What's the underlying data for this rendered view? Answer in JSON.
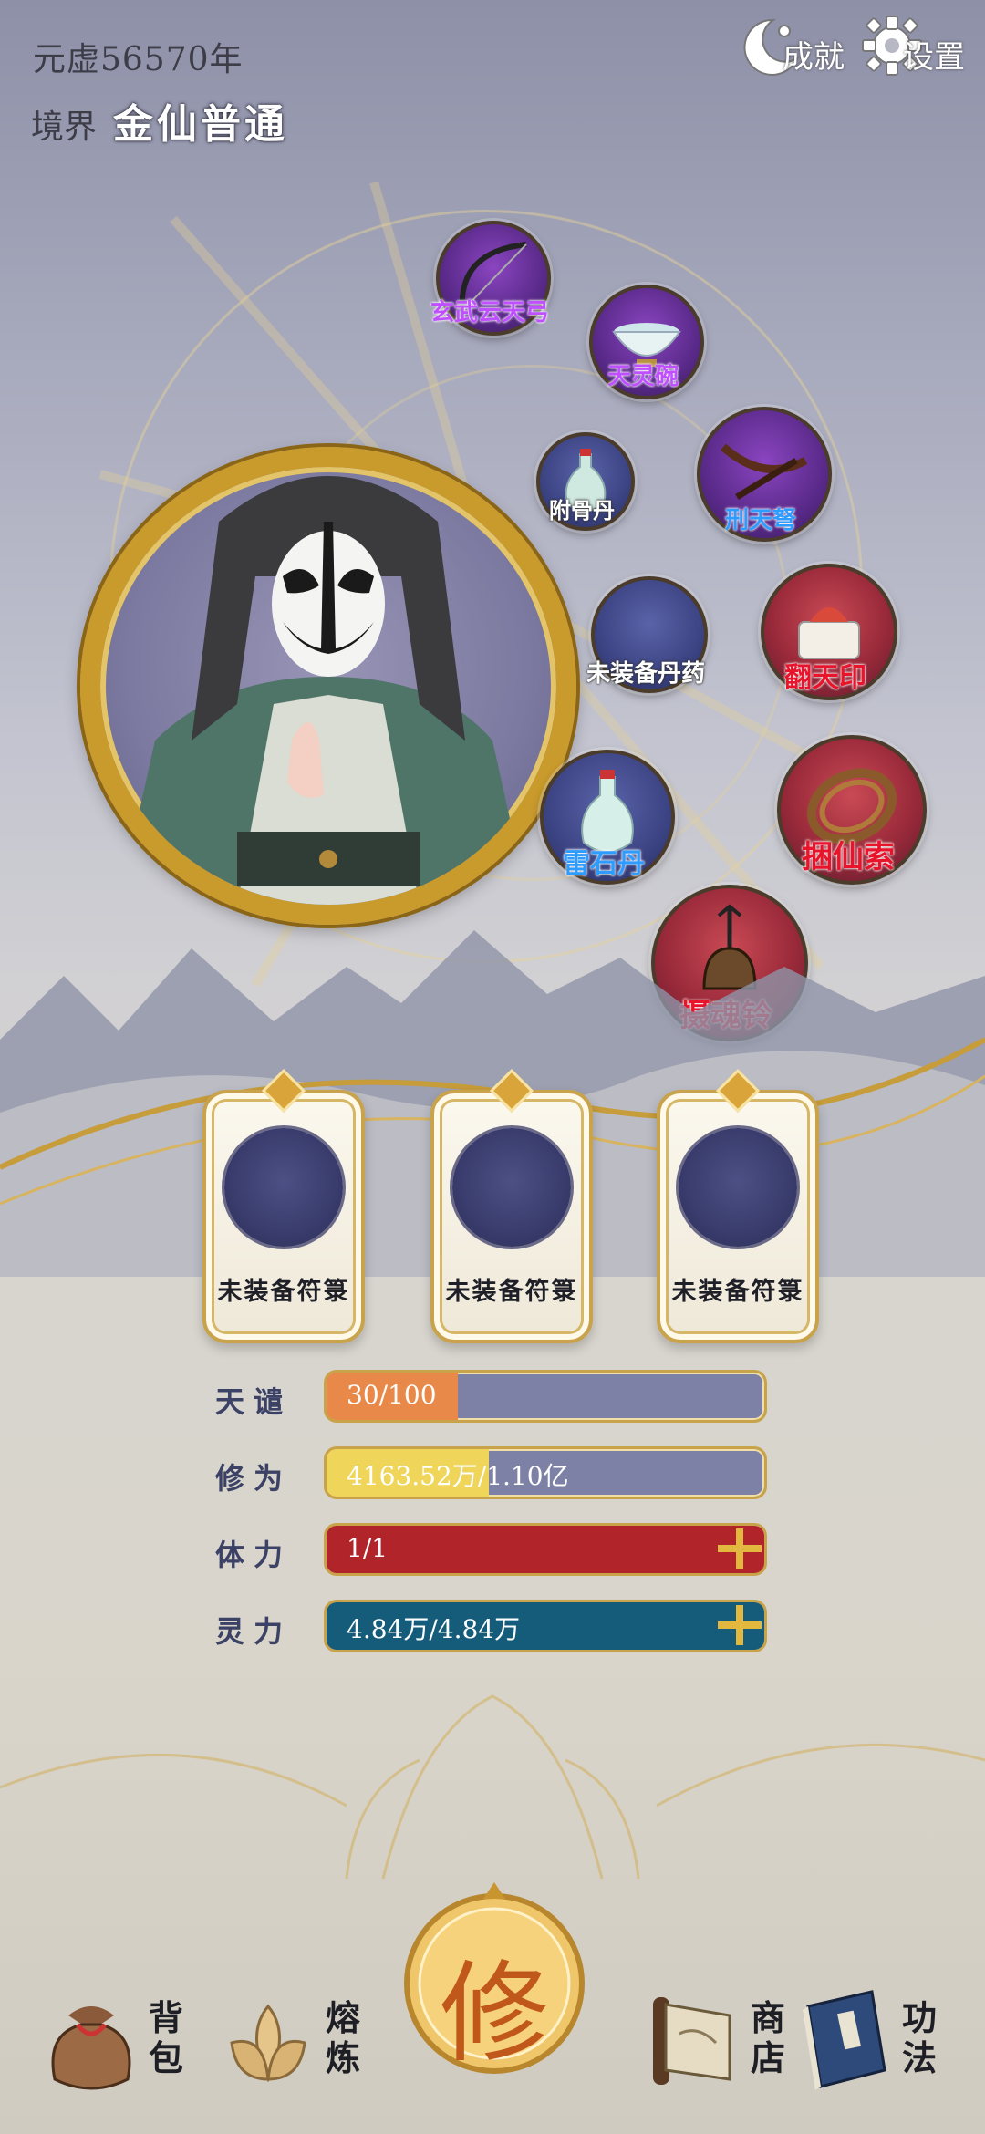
{
  "header": {
    "era_text": "元虚56570年",
    "realm_label": "境界",
    "realm_value": "金仙普通",
    "achievements_label": "成就",
    "achievements_icon": "crescent-moon-icon",
    "settings_label": "设置",
    "settings_icon": "gear-icon"
  },
  "equipment": [
    {
      "label": "玄武云天弓",
      "icon": "bow-icon",
      "color": "#c050ff"
    },
    {
      "label": "天灵碗",
      "icon": "bowl-icon",
      "color": "#c050ff"
    },
    {
      "label": "附骨丹",
      "icon": "vase-icon",
      "color": "#ffffff"
    },
    {
      "label": "刑天弩",
      "icon": "crossbow-icon",
      "color": "#2e9cff"
    },
    {
      "label": "未装备丹药",
      "icon": "",
      "color": "#ffffff"
    },
    {
      "label": "翻天印",
      "icon": "seal-icon",
      "color": "#e8142c"
    },
    {
      "label": "雷石丹",
      "icon": "vase-icon",
      "color": "#2e9cff"
    },
    {
      "label": "捆仙索",
      "icon": "rope-icon",
      "color": "#e8142c"
    },
    {
      "label": "摄魂铃",
      "icon": "bell-icon",
      "color": "#e8142c"
    }
  ],
  "talismans": [
    {
      "label": "未装备符箓"
    },
    {
      "label": "未装备符箓"
    },
    {
      "label": "未装备符箓"
    }
  ],
  "stats": [
    {
      "label": "天谴",
      "value": "30/100",
      "fill": 0.3,
      "color": "#e8894a"
    },
    {
      "label": "修为",
      "value": "4163.52万/1.10亿",
      "fill": 0.37,
      "color": "#efd55a"
    },
    {
      "label": "体力",
      "value": "1/1",
      "fill": 1.0,
      "color": "#b0242a"
    },
    {
      "label": "灵力",
      "value": "4.84万/4.84万",
      "fill": 1.0,
      "color": "#155c7a"
    }
  ],
  "nav": {
    "bag": "背包",
    "smelt": "熔炼",
    "cultivate": "修",
    "shop": "商店",
    "skills": "功法"
  }
}
